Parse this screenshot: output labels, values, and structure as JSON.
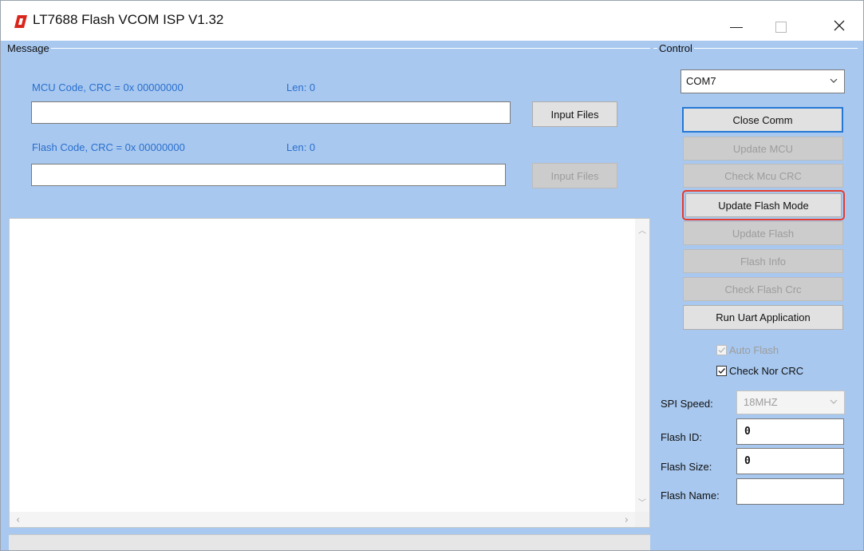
{
  "window": {
    "title": "LT7688 Flash VCOM ISP V1.32",
    "colors": {
      "panel": "#a8c8ef",
      "label_blue": "#2a6fcd",
      "focus": "#2477d5",
      "highlight": "#e53b2c"
    }
  },
  "message_group": {
    "label": "Message",
    "mcu_code": {
      "label": "MCU Code, CRC = 0x 00000000",
      "len_label": "Len:  0",
      "path_value": "",
      "button": "Input Files"
    },
    "flash_code": {
      "label": "Flash Code, CRC = 0x 00000000",
      "len_label": "Len:  0",
      "path_value": "",
      "button": "Input Files"
    },
    "log_text": ""
  },
  "control_group": {
    "label": "Control",
    "port": {
      "selected": "COM7"
    },
    "buttons": {
      "close_comm": "Close Comm",
      "update_mcu": "Update MCU",
      "check_mcu_crc": "Check Mcu CRC",
      "update_flash_mode": "Update Flash Mode",
      "update_flash": "Update Flash",
      "flash_info": "Flash Info",
      "check_flash_crc": "Check Flash Crc",
      "run_uart_app": "Run Uart Application"
    },
    "checkboxes": {
      "auto_flash": {
        "label": "Auto Flash",
        "checked": true,
        "enabled": false
      },
      "check_nor_crc": {
        "label": "Check Nor CRC",
        "checked": true,
        "enabled": true
      }
    },
    "spi_speed": {
      "label": "SPI Speed:",
      "value": "18MHZ"
    },
    "flash_id": {
      "label": "Flash ID:",
      "value": "0"
    },
    "flash_size": {
      "label": "Flash Size:",
      "value": "0"
    },
    "flash_name": {
      "label": "Flash Name:",
      "value": ""
    }
  }
}
